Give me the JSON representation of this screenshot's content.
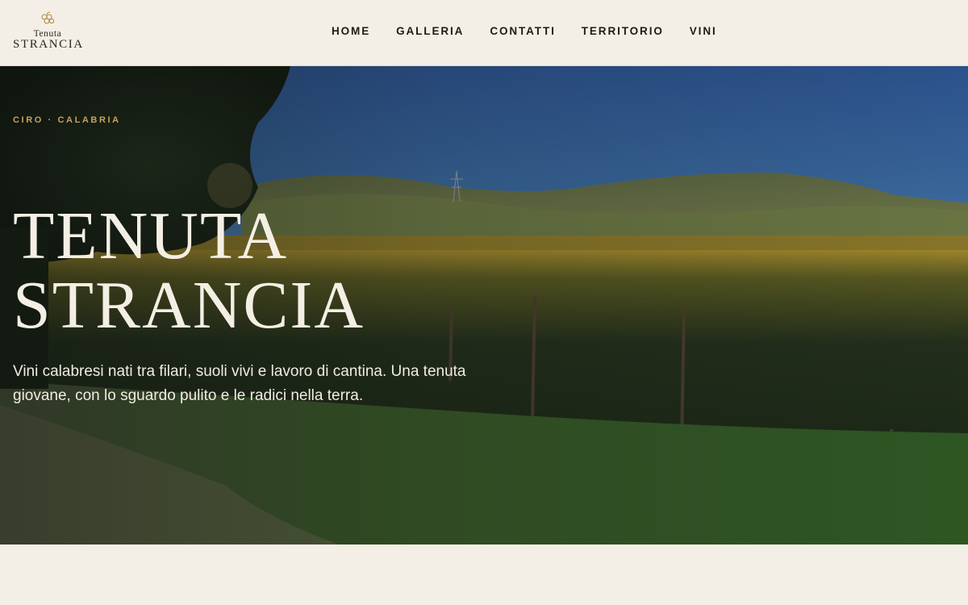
{
  "brand": {
    "line1": "Tenuta",
    "line2": "STRANCIA",
    "icon": "grape-cluster-icon"
  },
  "nav": {
    "items": [
      "HOME",
      "GALLERIA",
      "CONTATTI",
      "TERRITORIO",
      "VINI"
    ]
  },
  "hero": {
    "eyebrow": "CIRO · CALABRIA",
    "title_line1": "TENUTA",
    "title_line2": "STRANCIA",
    "description": "Vini calabresi nati tra filari, suoli vivi e lavoro di cantina. Una tenuta giovane, con lo sguardo pulito e le radici nella terra."
  },
  "colors": {
    "background": "#f3efe6",
    "accent": "#c9a15f",
    "text_dark": "#1f1b17",
    "text_light": "#f4efe4"
  }
}
